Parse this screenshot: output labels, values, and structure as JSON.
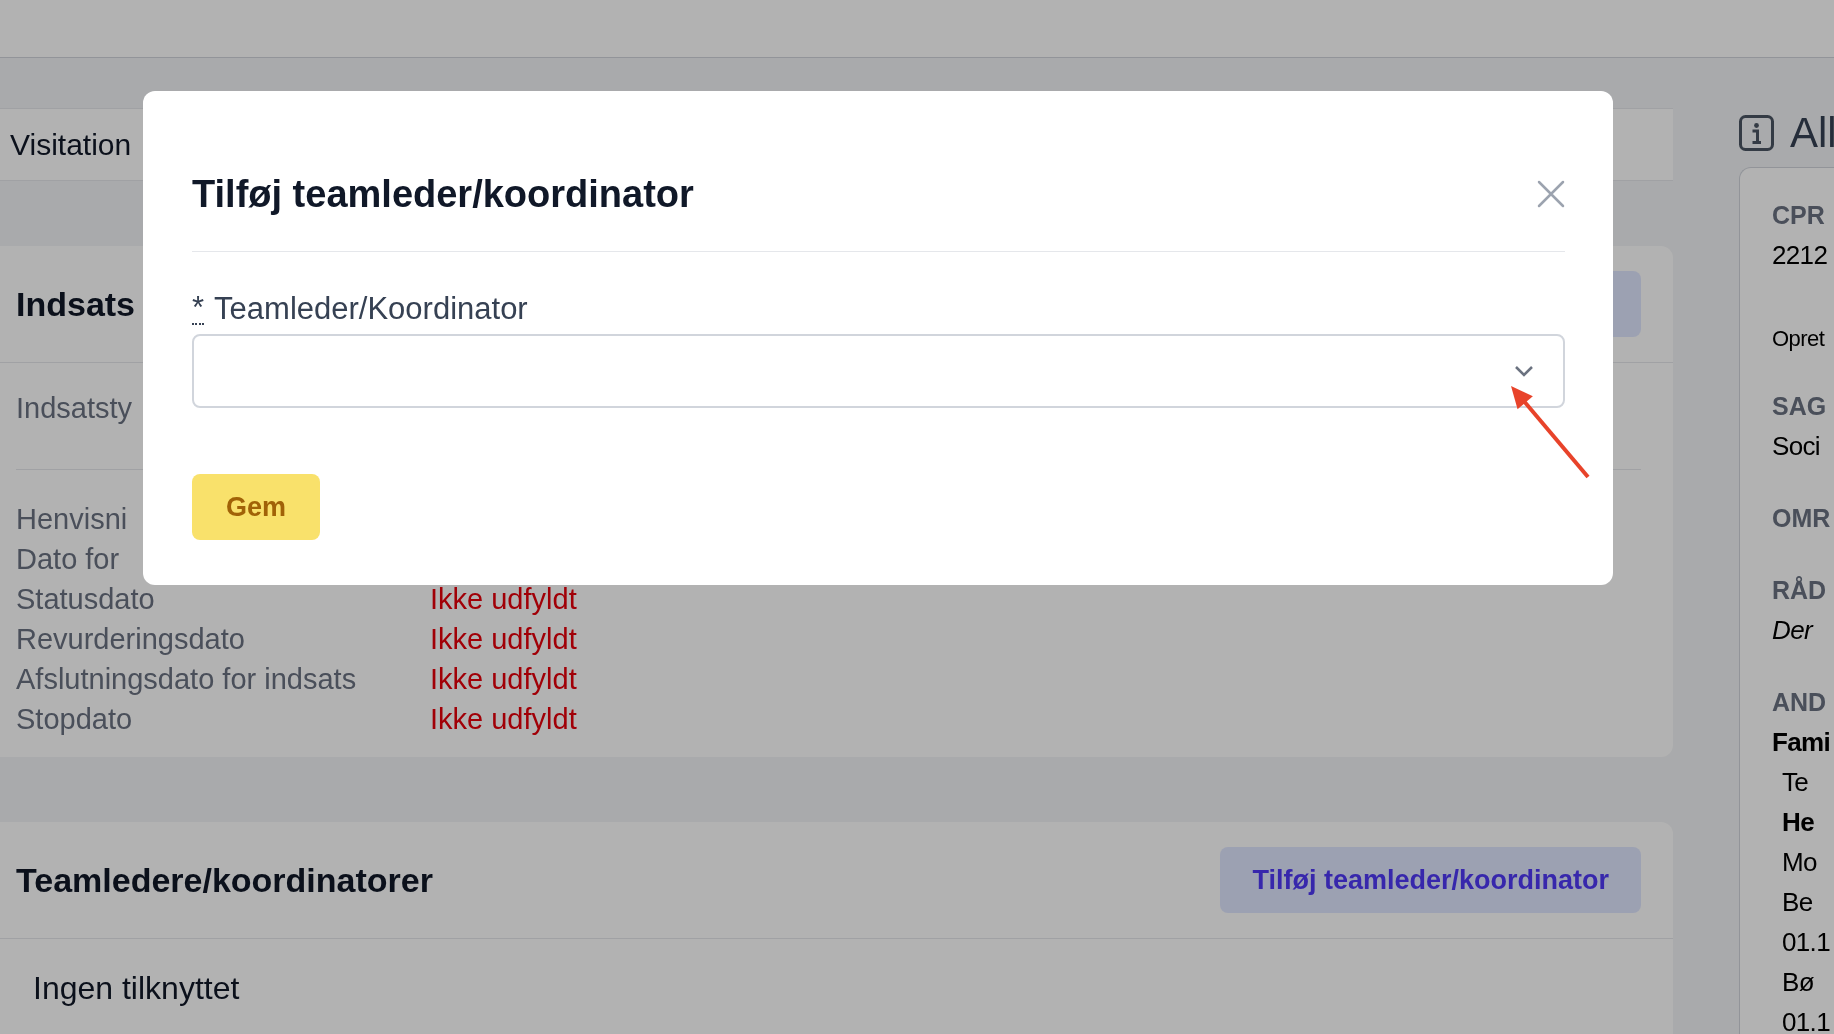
{
  "tabs": [
    {
      "label": "Visitation",
      "selected": false
    }
  ],
  "intervention_card": {
    "title": "Indsats",
    "type_row": {
      "label": "Indsatsty"
    },
    "fields": [
      {
        "label": "Henvisni"
      },
      {
        "label": "Dato for"
      },
      {
        "label": "Statusdato",
        "value": "Ikke udfyldt"
      },
      {
        "label": "Revurderingsdato",
        "value": "Ikke udfyldt"
      },
      {
        "label": "Afslutningsdato for indsats",
        "value": "Ikke udfyldt"
      },
      {
        "label": "Stopdato",
        "value": "Ikke udfyldt"
      }
    ]
  },
  "team_leads_card": {
    "title": "Teamledere/koordinatorer",
    "add_button": "Tilføj teamleder/koordinator",
    "empty_text": "Ingen tilknyttet"
  },
  "info_panel": {
    "title": "All",
    "sections": [
      {
        "label": "CPR",
        "lines": [
          {
            "kind": "plain",
            "text": "2212"
          },
          {
            "kind": "note",
            "text": "Opret"
          }
        ]
      },
      {
        "label": "SAG",
        "lines": [
          {
            "kind": "plain",
            "text": "Soci"
          }
        ]
      },
      {
        "label": "OMR"
      },
      {
        "label": "RÅD",
        "lines": [
          {
            "kind": "italic",
            "text": "Der"
          }
        ]
      },
      {
        "label": "AND",
        "lines": [
          {
            "kind": "bold",
            "text": "Fami",
            "children": [
              {
                "kind": "plain",
                "text": "Te"
              },
              {
                "kind": "bold",
                "text": "He"
              },
              {
                "kind": "plain",
                "text": "Mo"
              },
              {
                "kind": "plain",
                "text": "Be"
              },
              {
                "kind": "plain",
                "text": "01.1"
              },
              {
                "kind": "plain",
                "text": "Bø"
              },
              {
                "kind": "plain",
                "text": "01.1"
              }
            ]
          }
        ]
      }
    ]
  },
  "dialog": {
    "title": "Tilføj teamleder/koordinator",
    "field": {
      "required_mark": "*",
      "label": "Teamleder/Koordinator"
    },
    "save_button": "Gem"
  }
}
